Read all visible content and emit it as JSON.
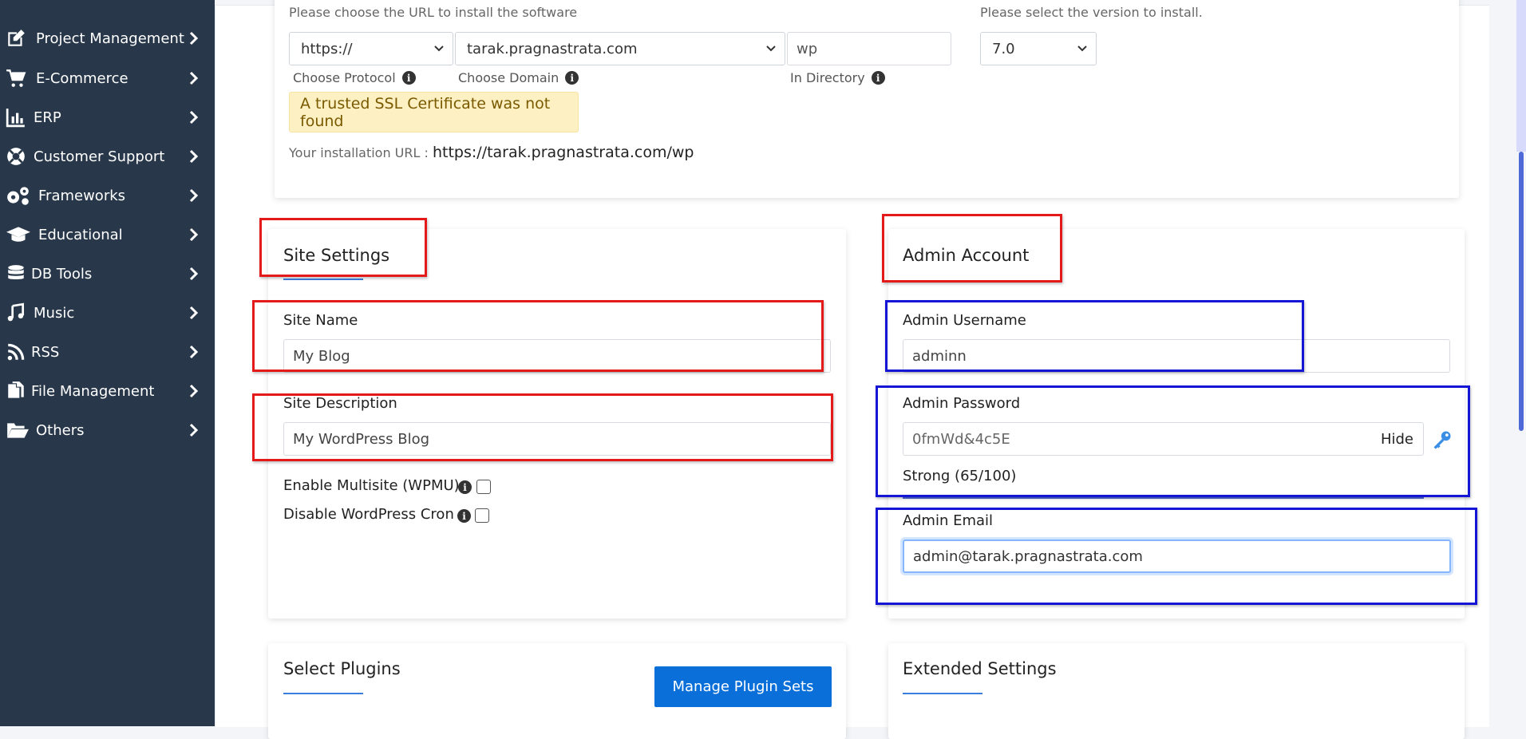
{
  "sidebar": {
    "items": [
      {
        "label": "Project Management",
        "icon": "edit-icon"
      },
      {
        "label": "E-Commerce",
        "icon": "cart-icon"
      },
      {
        "label": "ERP",
        "icon": "bar-chart-icon"
      },
      {
        "label": "Customer Support",
        "icon": "lifebuoy-icon"
      },
      {
        "label": "Frameworks",
        "icon": "gears-icon"
      },
      {
        "label": "Educational",
        "icon": "graduation-cap-icon"
      },
      {
        "label": "DB Tools",
        "icon": "database-icon"
      },
      {
        "label": "Music",
        "icon": "music-icon"
      },
      {
        "label": "RSS",
        "icon": "rss-icon"
      },
      {
        "label": "File Management",
        "icon": "files-icon"
      },
      {
        "label": "Others",
        "icon": "folder-open-icon"
      }
    ]
  },
  "install": {
    "url_hint": "Please choose the URL to install the software",
    "version_hint": "Please select the version to install.",
    "protocol": "https://",
    "domain": "tarak.pragnastrata.com",
    "directory": "wp",
    "version": "7.0",
    "protocol_label": "Choose Protocol",
    "domain_label": "Choose Domain",
    "directory_label": "In Directory",
    "ssl_alert": "A trusted SSL Certificate was not found",
    "install_url_label": "Your installation URL :",
    "install_url": "https://tarak.pragnastrata.com/wp"
  },
  "site_settings": {
    "title": "Site Settings",
    "site_name_label": "Site Name",
    "site_name": "My Blog",
    "site_desc_label": "Site Description",
    "site_desc": "My WordPress Blog",
    "multisite_label": "Enable Multisite (WPMU)",
    "cron_label": "Disable WordPress Cron"
  },
  "admin_account": {
    "title": "Admin Account",
    "username_label": "Admin Username",
    "username": "adminn",
    "password_label": "Admin Password",
    "password": "0fmWd&4c5E",
    "hide_label": "Hide",
    "strength": "Strong (65/100)",
    "email_label": "Admin Email",
    "email": "admin@tarak.pragnastrata.com"
  },
  "plugins": {
    "title": "Select Plugins",
    "manage_button": "Manage Plugin Sets"
  },
  "extended": {
    "title": "Extended Settings"
  },
  "colors": {
    "sidebar_bg": "#28384a",
    "accent": "#0a6fd8",
    "annotation_red": "#e41a1a",
    "annotation_blue": "#1515d6"
  }
}
